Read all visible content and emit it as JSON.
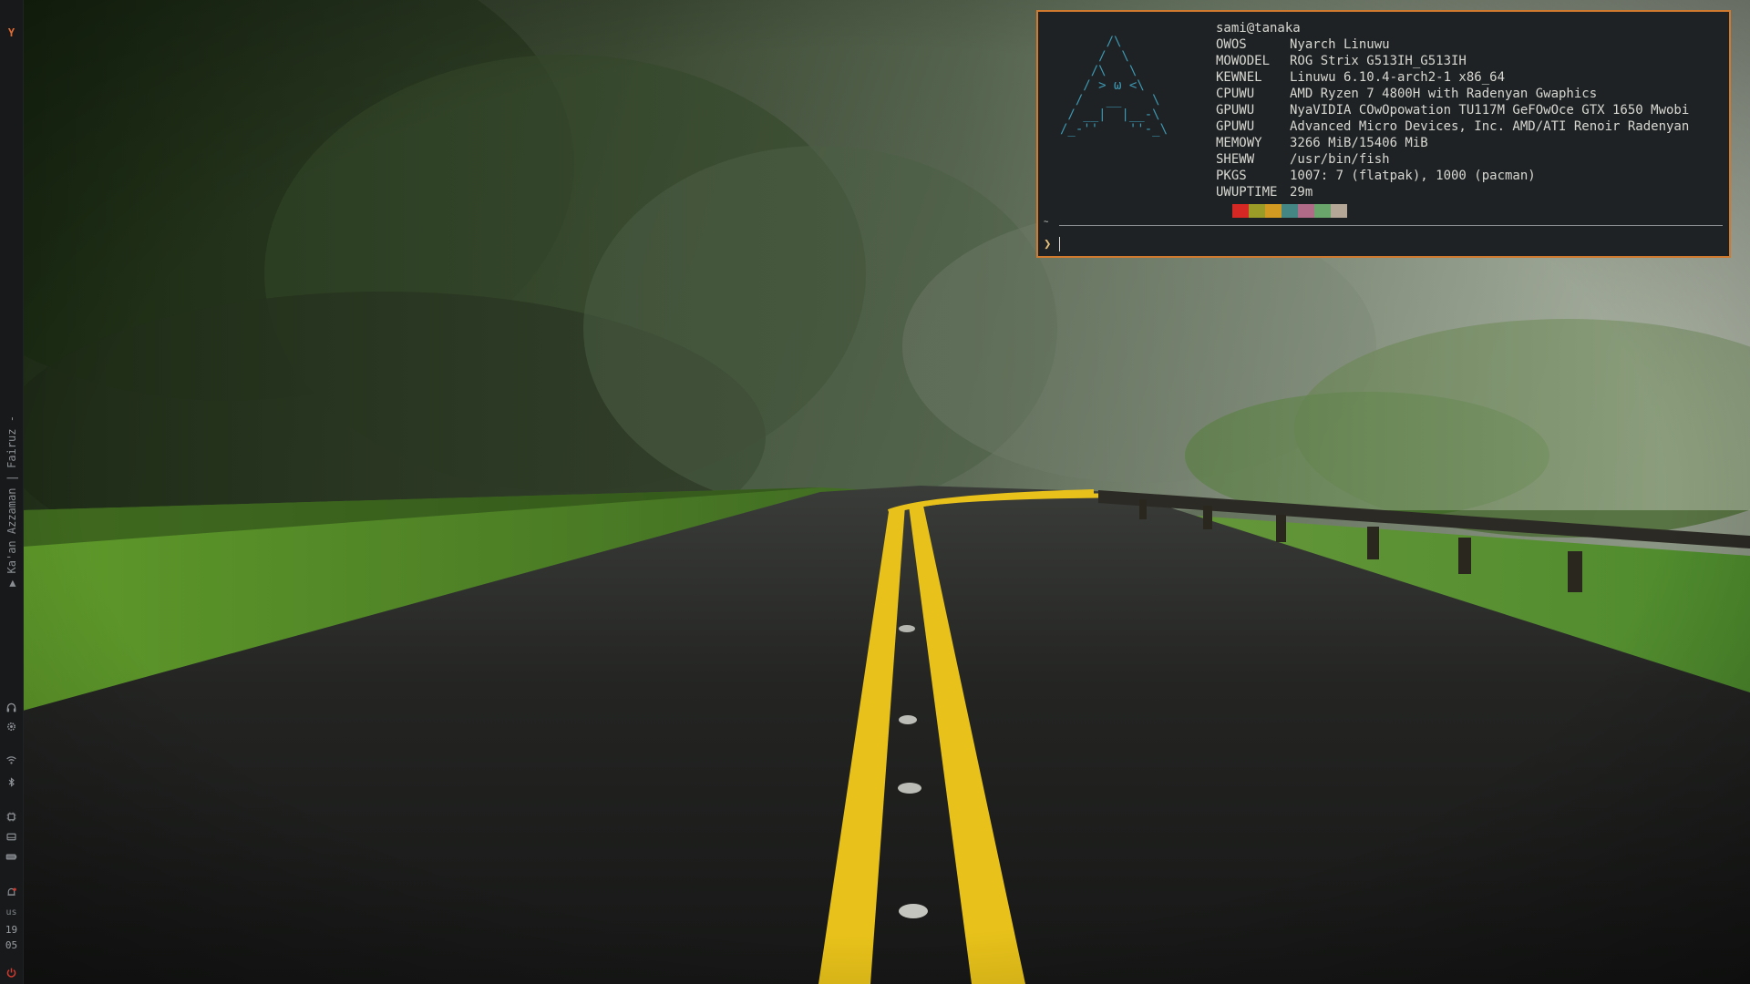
{
  "bar": {
    "launcher_glyph": "Y",
    "media_text": "▶ Ka'an Azzaman | Fairuz -",
    "keyboard_layout": "us",
    "clock_hour": "19",
    "clock_minute": "05",
    "icons": [
      "launcher-icon",
      "headphones-icon",
      "gear-icon",
      "wifi-icon",
      "bluetooth-icon",
      "cpu-icon",
      "storage-icon",
      "battery-icon",
      "notification-bell-icon",
      "power-icon"
    ]
  },
  "terminal": {
    "title": "sami@tanaka",
    "logo_lines": [
      "      /\\",
      "     /  \\",
      "    /\\   \\",
      "   / > ω <\\",
      "  /   __    \\",
      " / __|  |__-\\",
      "/_-''    ''-_\\"
    ],
    "rows": [
      {
        "key": "OWOS",
        "value": "Nyarch Linuwu"
      },
      {
        "key": "MOWODEL",
        "value": "ROG Strix G513IH_G513IH"
      },
      {
        "key": "KEWNEL",
        "value": "Linuwu 6.10.4-arch2-1 x86_64"
      },
      {
        "key": "CPUWU",
        "value": "AMD Ryzen 7 4800H with Radenyan Gwaphics"
      },
      {
        "key": "GPUWU",
        "value": "NyaVIDIA COwOpowation TU117M GeFOwOce GTX 1650 Mwobi"
      },
      {
        "key": "GPUWU",
        "value": "Advanced Micro Devices, Inc. AMD/ATI Renoir Radenyan"
      },
      {
        "key": "MEMOWY",
        "value": "3266 MiB/15406 MiB"
      },
      {
        "key": "SHEWW",
        "value": "/usr/bin/fish"
      },
      {
        "key": "PKGS",
        "value": "1007: 7 (flatpak), 1000 (pacman)"
      },
      {
        "key": "UWUPTIME",
        "value": "29m"
      }
    ],
    "palette": [
      "#1e2224",
      "#d52723",
      "#9b9c28",
      "#d39a22",
      "#448684",
      "#b06b88",
      "#6aa56b",
      "#b5a797"
    ],
    "prompt_dir": "~",
    "prompt_symbol": "❯",
    "accent_color": "#d07a30",
    "logo_color": "#3e99b3"
  }
}
